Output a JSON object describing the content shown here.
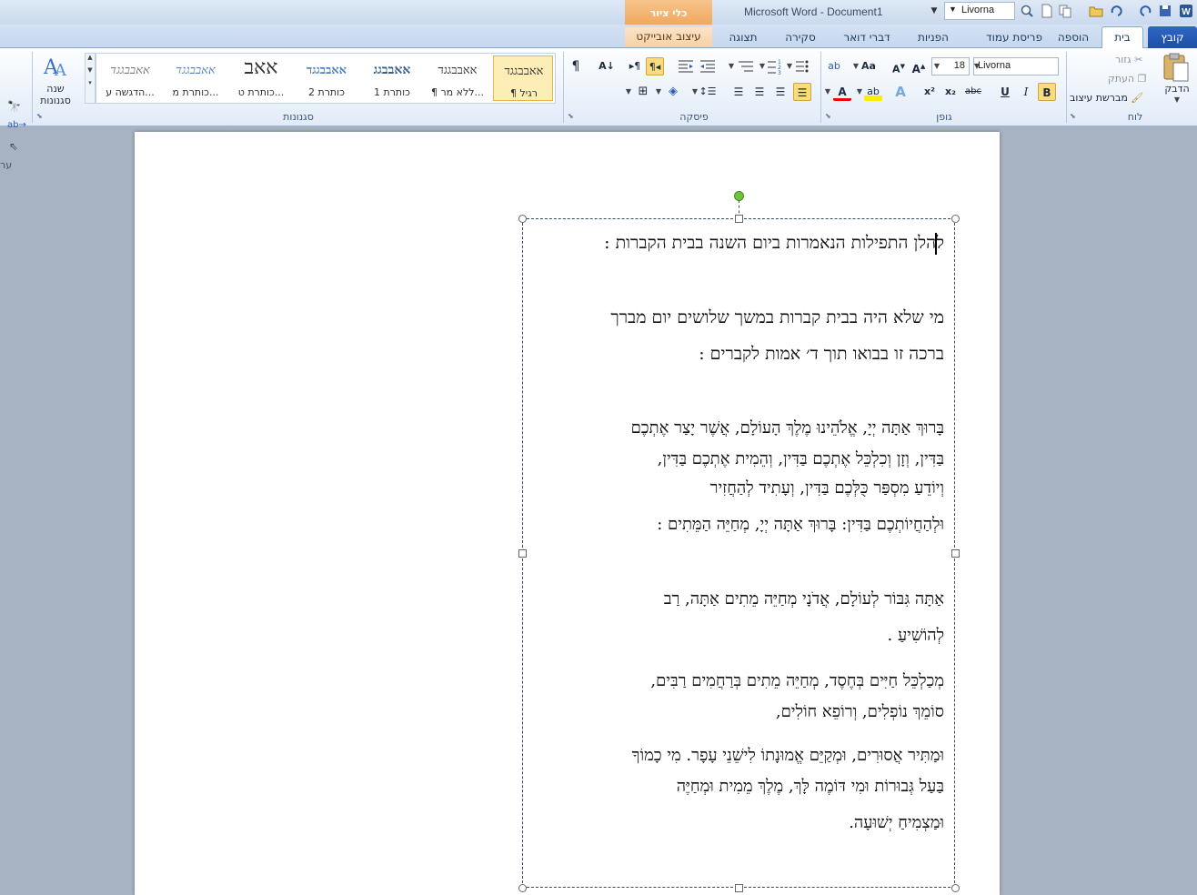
{
  "window": {
    "title": "Microsoft Word - Document1",
    "quick_font": "Livorna",
    "contextual_group": "כלי ציור"
  },
  "tabs": [
    "קובץ",
    "בית",
    "הוספה",
    "פריסת עמוד",
    "הפניות",
    "דברי דואר",
    "סקירה",
    "תצוגה",
    "עיצוב אובייקט"
  ],
  "ribbon": {
    "clipboard": {
      "label": "לוח",
      "paste": "הדבק",
      "cut": "גזור",
      "copy": "העתק",
      "format_painter": "מברשת עיצוב"
    },
    "font": {
      "label": "גופן",
      "name": "Livorna",
      "size": "18"
    },
    "paragraph": {
      "label": "פיסקה"
    },
    "styles": {
      "label": "סגנונות",
      "change_styles": "שנה סגנונות",
      "items": [
        {
          "sample": "אאבבגגד",
          "name": "¶ רגיל"
        },
        {
          "sample": "אאבבגגד",
          "name": "¶ ללא מר..."
        },
        {
          "sample": "אאבבגג",
          "name": "כותרת 1"
        },
        {
          "sample": "אאבבגגד",
          "name": "כותרת 2"
        },
        {
          "sample": "אאב",
          "name": "כותרת ט..."
        },
        {
          "sample": "אאבבגגד",
          "name": "כותרת מ..."
        },
        {
          "sample": "אאבבגגד",
          "name": "הדגשה ע..."
        }
      ]
    },
    "editing": {
      "label": "ער"
    }
  },
  "document": {
    "lines": [
      "להלן התפילות הנאמרות ביום השנה בבית הקברות :",
      "מי שלא היה בבית קברות במשך שלושים יום מברך",
      "ברכה זו בבואו תוך ד׳ אמות לקברים :",
      "בָּרוּךְ אַתָּה יְיָ, אֱלֹהֵינוּ מֶלֶךְ הָעוֹלָם, אֲשֶׁר יָצַר אֶתְכֶם",
      "בַּדִּין, וְזָן וְכִלְכֵּל אֶתְכֶם בַּדִּין, וְהֵמִית אֶתְכֶם בַּדִּין,",
      "וְיוֹדֵעַ מִסְפַּר כֻּלְּכֶם בַּדִּין, וְעָתִיד לְהַחֲזִיר",
      "וּלְהַחֲיוֹתְכֶם בַּדִּין: בָּרוּךְ אַתָּה יְיָ, מְחַיֵּה הַמֵּתִים :",
      "אַתָּה גִּבּוֹר לְעוֹלָם, אֲדֹנָי מְחַיֵּה מֵתִים אַתָּה, רַב",
      "לְהוֹשִׁיעַ .",
      "מְכַלְכֵּל חַיִּים בְּחֶסֶד, מְחַיֵּה מֵתִים בְּרַחֲמִים רַבִּים,",
      "סוֹמֵךְ נוֹפְלִים, וְרוֹפֵא חוֹלִים,",
      "וּמַתִּיר אֲסוּרִים, וּמְקַיֵּם אֱמוּנָתוֹ לִישֵׁנֵי עָפָר. מִי כָמוֹךָ",
      "בַּעַל גְּבוּרוֹת וּמִי דּוֹמֶה לָּךְ, מֶלֶךְ מֵמִית וּמְחַיֶּה",
      "וּמַצְמִיחַ יְשׁוּעָה."
    ]
  }
}
